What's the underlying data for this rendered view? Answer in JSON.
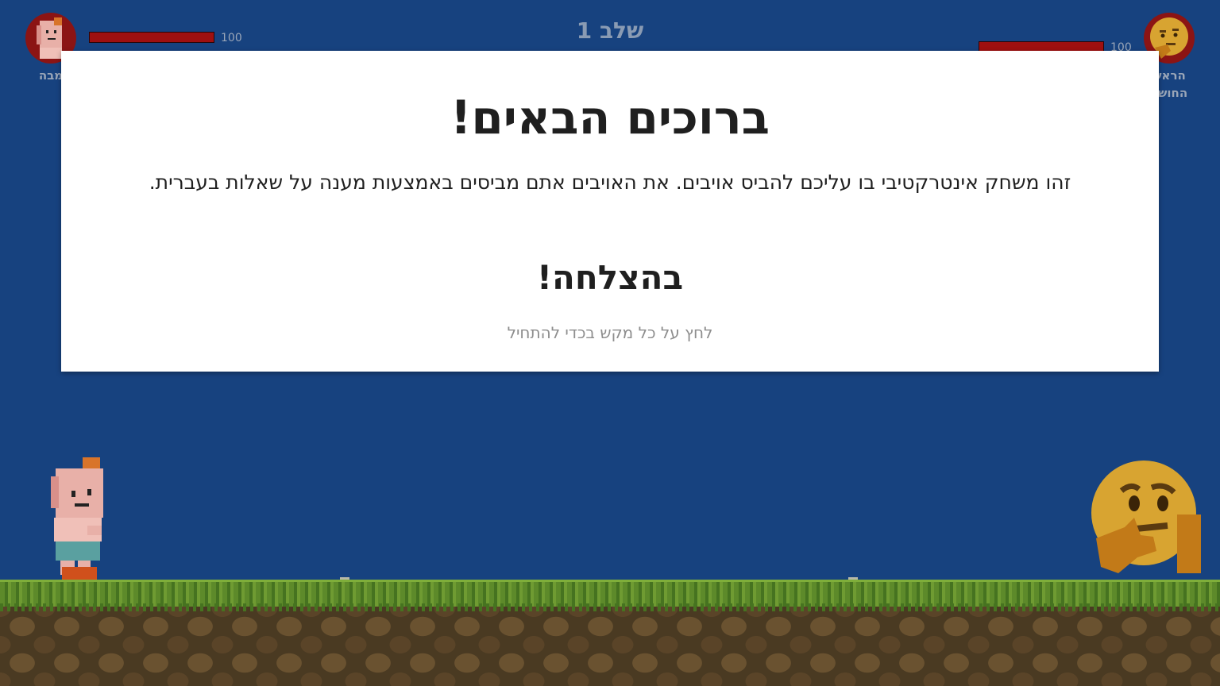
{
  "hud": {
    "level_label": "שלב 1",
    "player": {
      "name": "מבה",
      "hp": 100,
      "hp_fraction": 1.0
    },
    "enemy": {
      "name_line1": "הראש",
      "name_line2": "החושב",
      "hp": 100,
      "hp_fraction": 1.0
    }
  },
  "modal": {
    "title": "ברוכים הבאים!",
    "body": "זהו משחק אינטרקטיבי בו עליכם להביס אויבים. את האויבים אתם מביסים באמצעות מענה על שאלות בעברית.",
    "subtitle": "בהצלחה!",
    "hint": "לחץ על כל מקש בכדי להתחיל"
  },
  "colors": {
    "background": "#17427f",
    "hp_bar": "#9e1010",
    "modal_bg": "#ffffff",
    "grass": "#5d8a2a",
    "dirt": "#4a3a22"
  },
  "icons": {
    "player_avatar": "pixel-girl-icon",
    "enemy_avatar": "thinking-face-icon"
  }
}
